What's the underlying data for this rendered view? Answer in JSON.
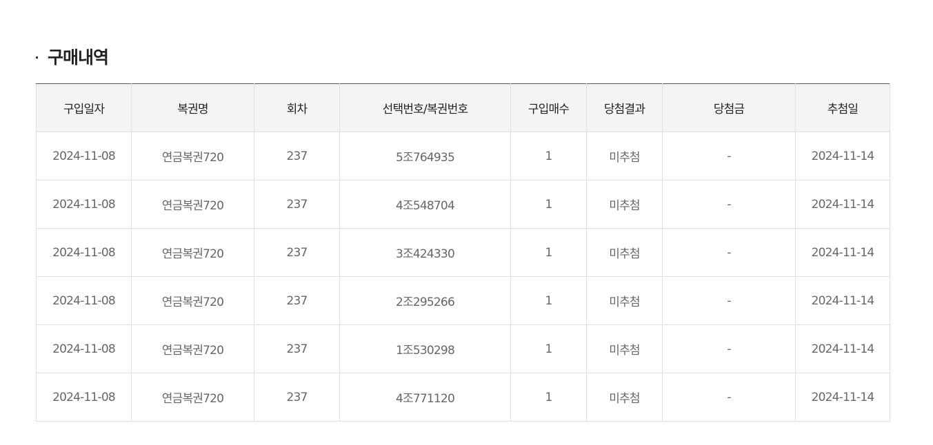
{
  "section": {
    "title": "구매내역"
  },
  "table": {
    "headers": [
      "구입일자",
      "복권명",
      "회차",
      "선택번호/복권번호",
      "구입매수",
      "당첨결과",
      "당첨금",
      "추첨일"
    ],
    "rows": [
      [
        "2024-11-08",
        "연금복권720",
        "237",
        "5조764935",
        "1",
        "미추첨",
        "-",
        "2024-11-14"
      ],
      [
        "2024-11-08",
        "연금복권720",
        "237",
        "4조548704",
        "1",
        "미추첨",
        "-",
        "2024-11-14"
      ],
      [
        "2024-11-08",
        "연금복권720",
        "237",
        "3조424330",
        "1",
        "미추첨",
        "-",
        "2024-11-14"
      ],
      [
        "2024-11-08",
        "연금복권720",
        "237",
        "2조295266",
        "1",
        "미추첨",
        "-",
        "2024-11-14"
      ],
      [
        "2024-11-08",
        "연금복권720",
        "237",
        "1조530298",
        "1",
        "미추첨",
        "-",
        "2024-11-14"
      ],
      [
        "2024-11-08",
        "연금복권720",
        "237",
        "4조771120",
        "1",
        "미추첨",
        "-",
        "2024-11-14"
      ]
    ]
  }
}
